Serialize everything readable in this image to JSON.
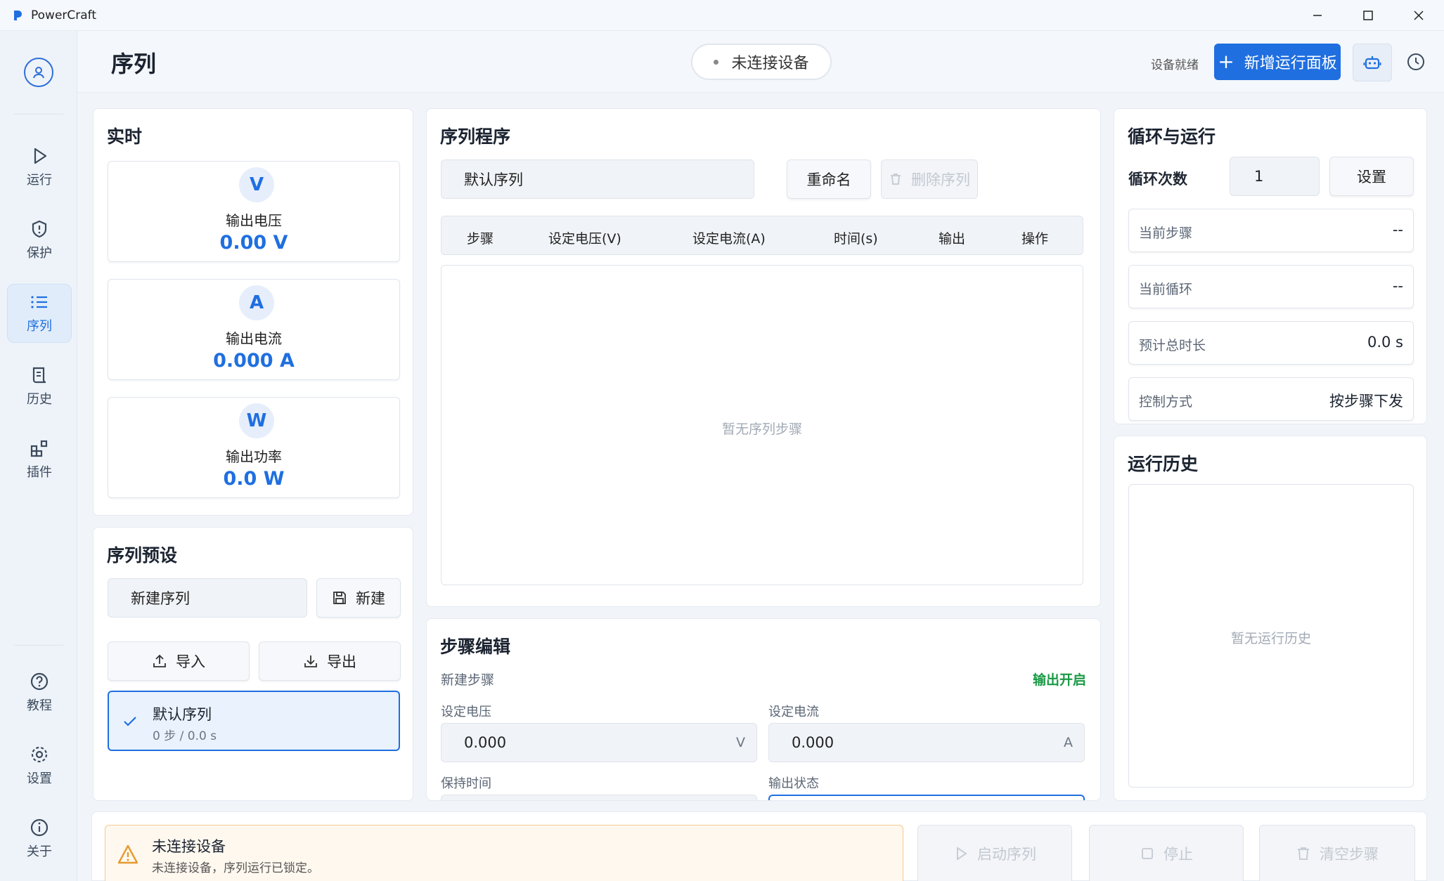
{
  "window": {
    "title": "PowerCraft"
  },
  "sidebar": {
    "items": [
      {
        "label": "运行",
        "icon": "play-icon"
      },
      {
        "label": "保护",
        "icon": "shield-icon"
      },
      {
        "label": "序列",
        "icon": "list-icon",
        "active": true
      },
      {
        "label": "历史",
        "icon": "scroll-icon"
      },
      {
        "label": "插件",
        "icon": "plugin-icon"
      }
    ],
    "bottom": [
      {
        "label": "教程",
        "icon": "help-icon"
      },
      {
        "label": "设置",
        "icon": "gear-icon"
      },
      {
        "label": "关于",
        "icon": "info-icon"
      }
    ]
  },
  "header": {
    "title": "序列",
    "connection_status": "未连接设备",
    "device_status": "设备就绪",
    "add_panel_label": "新增运行面板"
  },
  "realtime": {
    "title": "实时",
    "metrics": [
      {
        "badge": "V",
        "label": "输出电压",
        "value": "0.00 V"
      },
      {
        "badge": "A",
        "label": "输出电流",
        "value": "0.000 A"
      },
      {
        "badge": "W",
        "label": "输出功率",
        "value": "0.0 W"
      }
    ]
  },
  "presets": {
    "title": "序列预设",
    "name_value": "新建序列",
    "new_label": "新建",
    "import_label": "导入",
    "export_label": "导出",
    "items": [
      {
        "name": "默认序列",
        "meta": "0 步 / 0.0 s",
        "selected": true
      }
    ]
  },
  "program": {
    "title": "序列程序",
    "sequence_name": "默认序列",
    "rename_label": "重命名",
    "delete_label": "删除序列",
    "columns": [
      "步骤",
      "设定电压(V)",
      "设定电流(A)",
      "时间(s)",
      "输出",
      "操作"
    ],
    "empty_text": "暂无序列步骤"
  },
  "step_edit": {
    "title": "步骤编辑",
    "subtitle": "新建步骤",
    "output_state_badge": "输出开启",
    "voltage_label": "设定电压",
    "voltage_value": "0.000",
    "voltage_unit": "V",
    "current_label": "设定电流",
    "current_value": "0.000",
    "current_unit": "A",
    "hold_label": "保持时间",
    "output_label": "输出状态"
  },
  "loop": {
    "title": "循环与运行",
    "count_label": "循环次数",
    "count_value": "1",
    "set_label": "设置",
    "rows": [
      {
        "label": "当前步骤",
        "value": "--"
      },
      {
        "label": "当前循环",
        "value": "--"
      },
      {
        "label": "预计总时长",
        "value": "0.0 s"
      },
      {
        "label": "控制方式",
        "value": "按步骤下发"
      }
    ]
  },
  "run_history": {
    "title": "运行历史",
    "empty_text": "暂无运行历史"
  },
  "footer": {
    "warning_title": "未连接设备",
    "warning_text": "未连接设备，序列运行已锁定。",
    "start_label": "启动序列",
    "stop_label": "停止",
    "clear_label": "清空步骤"
  },
  "colors": {
    "accent": "#1f6fe0",
    "success": "#1a9a45",
    "warning": "#e59a2f"
  }
}
